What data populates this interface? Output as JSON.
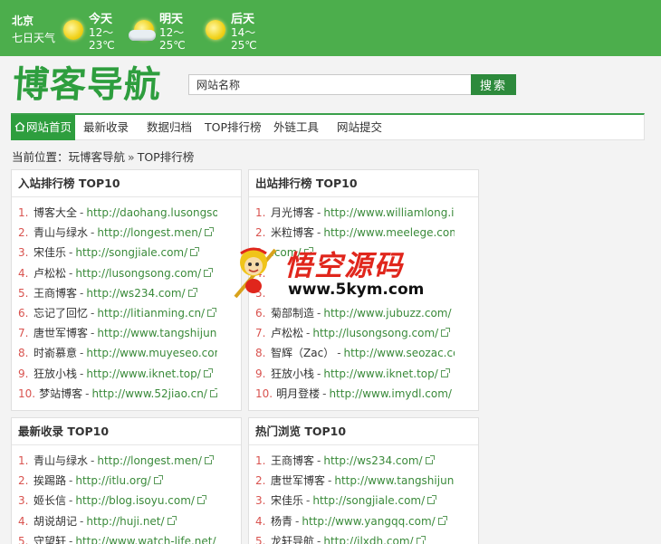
{
  "weather": {
    "city": "北京",
    "caption": "七日天气",
    "days": [
      {
        "label": "今天",
        "low": "12～",
        "high": "23℃",
        "icon": "sun-icon"
      },
      {
        "label": "明天",
        "low": "12～",
        "high": "25℃",
        "icon": "sun-cloud-icon"
      },
      {
        "label": "后天",
        "low": "14～",
        "high": "25℃",
        "icon": "sun-icon"
      }
    ]
  },
  "logo": "博客导航",
  "search": {
    "placeholder": "网站名称",
    "button": "搜索"
  },
  "nav": [
    {
      "label": "网站首页",
      "active": true
    },
    {
      "label": "最新收录"
    },
    {
      "label": "数据归档"
    },
    {
      "label": "TOP排行榜"
    },
    {
      "label": "外链工具"
    },
    {
      "label": "网站提交"
    }
  ],
  "breadcrumb": {
    "prefix": "当前位置：",
    "home": "玩博客导航",
    "sep": "»",
    "current": "TOP排行榜"
  },
  "panels": {
    "in_rank": {
      "title": "入站排行榜 TOP10",
      "items": [
        {
          "num": "1.",
          "name": "博客大全",
          "url": "http://daohang.lusongsong.com/"
        },
        {
          "num": "2.",
          "name": "青山与绿水",
          "url": "http://longest.men/"
        },
        {
          "num": "3.",
          "name": "宋佳乐",
          "url": "http://songjiale.com/"
        },
        {
          "num": "4.",
          "name": "卢松松",
          "url": "http://lusongsong.com/"
        },
        {
          "num": "5.",
          "name": "王商博客",
          "url": "http://ws234.com/"
        },
        {
          "num": "6.",
          "name": "忘记了回忆",
          "url": "http://litianming.cn/"
        },
        {
          "num": "7.",
          "name": "唐世军博客",
          "url": "http://www.tangshijun.cc/"
        },
        {
          "num": "8.",
          "name": "时嵛慕意",
          "url": "http://www.muyeseo.com/"
        },
        {
          "num": "9.",
          "name": "狂放小栈",
          "url": "http://www.iknet.top/"
        },
        {
          "num": "10.",
          "name": "梦站博客",
          "url": "http://www.52jiao.cn/"
        }
      ]
    },
    "out_rank": {
      "title": "出站排行榜 TOP10",
      "items": [
        {
          "num": "1.",
          "name": "月光博客",
          "url": "http://www.williamlong.info/"
        },
        {
          "num": "2.",
          "name": "米粒博客",
          "url": "http://www.meelege.com/"
        },
        {
          "num": "3.",
          "name": "",
          "url": ".com/"
        },
        {
          "num": "4.",
          "name": "",
          "url": ""
        },
        {
          "num": "5.",
          "name": "",
          "url": ""
        },
        {
          "num": "6.",
          "name": "菊部制造",
          "url": "http://www.jubuzz.com/"
        },
        {
          "num": "7.",
          "name": "卢松松",
          "url": "http://lusongsong.com/"
        },
        {
          "num": "8.",
          "name": "智辉（Zac）",
          "url": "http://www.seozac.com/"
        },
        {
          "num": "9.",
          "name": "狂放小栈",
          "url": "http://www.iknet.top/"
        },
        {
          "num": "10.",
          "name": "明月登楼",
          "url": "http://www.imydl.com/"
        }
      ]
    },
    "new": {
      "title": "最新收录 TOP10",
      "items": [
        {
          "num": "1.",
          "name": "青山与绿水",
          "url": "http://longest.men/"
        },
        {
          "num": "2.",
          "name": "挨踢路",
          "url": "http://itlu.org/"
        },
        {
          "num": "3.",
          "name": "姬长信",
          "url": "http://blog.isoyu.com/"
        },
        {
          "num": "4.",
          "name": "胡说胡记",
          "url": "http://huji.net/"
        },
        {
          "num": "5.",
          "name": "守望轩",
          "url": "http://www.watch-life.net/"
        }
      ]
    },
    "hot": {
      "title": "热门浏览 TOP10",
      "items": [
        {
          "num": "1.",
          "name": "王商博客",
          "url": "http://ws234.com/"
        },
        {
          "num": "2.",
          "name": "唐世军博客",
          "url": "http://www.tangshijun.cc/"
        },
        {
          "num": "3.",
          "name": "宋佳乐",
          "url": "http://songjiale.com/"
        },
        {
          "num": "4.",
          "name": "杨青",
          "url": "http://www.yangqq.com/"
        },
        {
          "num": "5.",
          "name": "龙轩导航",
          "url": "http://ilxdh.com/"
        }
      ]
    }
  },
  "watermark": {
    "title": "悟空源码",
    "site": "www.5kym.com"
  }
}
